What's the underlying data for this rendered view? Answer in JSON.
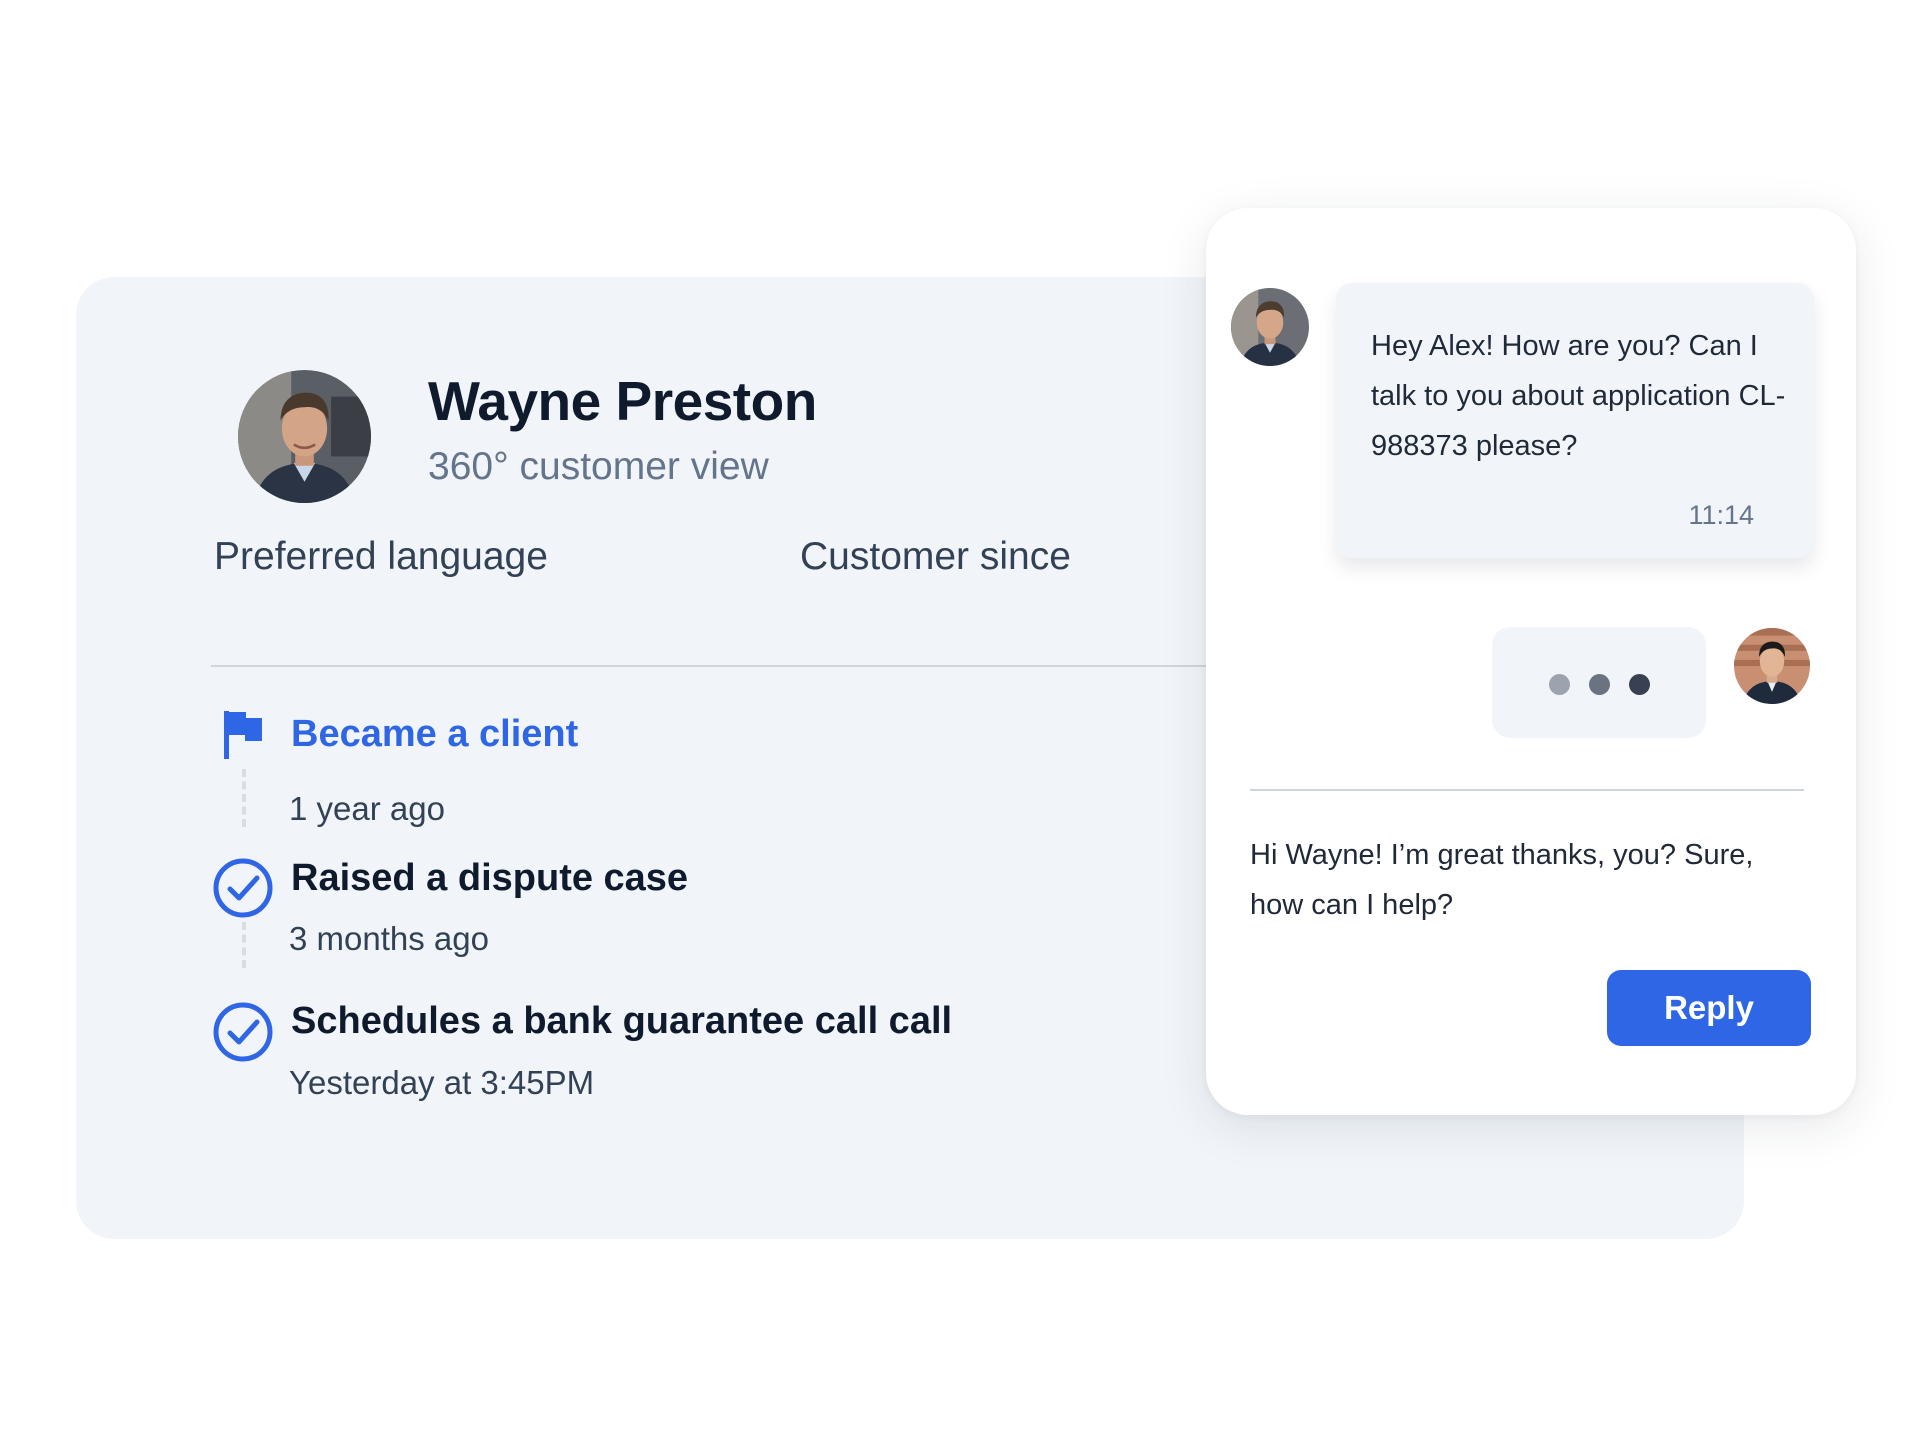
{
  "customer": {
    "name": "Wayne Preston",
    "subtitle": "360° customer view",
    "fields": {
      "preferred_language_label": "Preferred language",
      "customer_since_label": "Customer since"
    }
  },
  "timeline": [
    {
      "title": "Became a client",
      "time": "1 year ago",
      "icon": "flag-icon"
    },
    {
      "title": "Raised a dispute case",
      "time": "3 months ago",
      "icon": "check-circle-icon"
    },
    {
      "title": "Schedules a bank guarantee call call",
      "time": "Yesterday at 3:45PM",
      "icon": "check-circle-icon"
    }
  ],
  "chat": {
    "incoming_message": {
      "text": "Hey Alex! How are you? Can I talk to you about application CL-988373 please?",
      "time": "11:14"
    },
    "typing_indicator": true,
    "draft_reply": "Hi Wayne! I’m great thanks, you? Sure, how can I help?",
    "reply_button_label": "Reply"
  },
  "colors": {
    "accent": "#2f66e6",
    "card_background": "#f1f5f9",
    "heading": "#0f1b2d",
    "muted_text": "#64748b",
    "typing_dots": [
      "#9ca3af",
      "#6b7280",
      "#374151"
    ]
  }
}
